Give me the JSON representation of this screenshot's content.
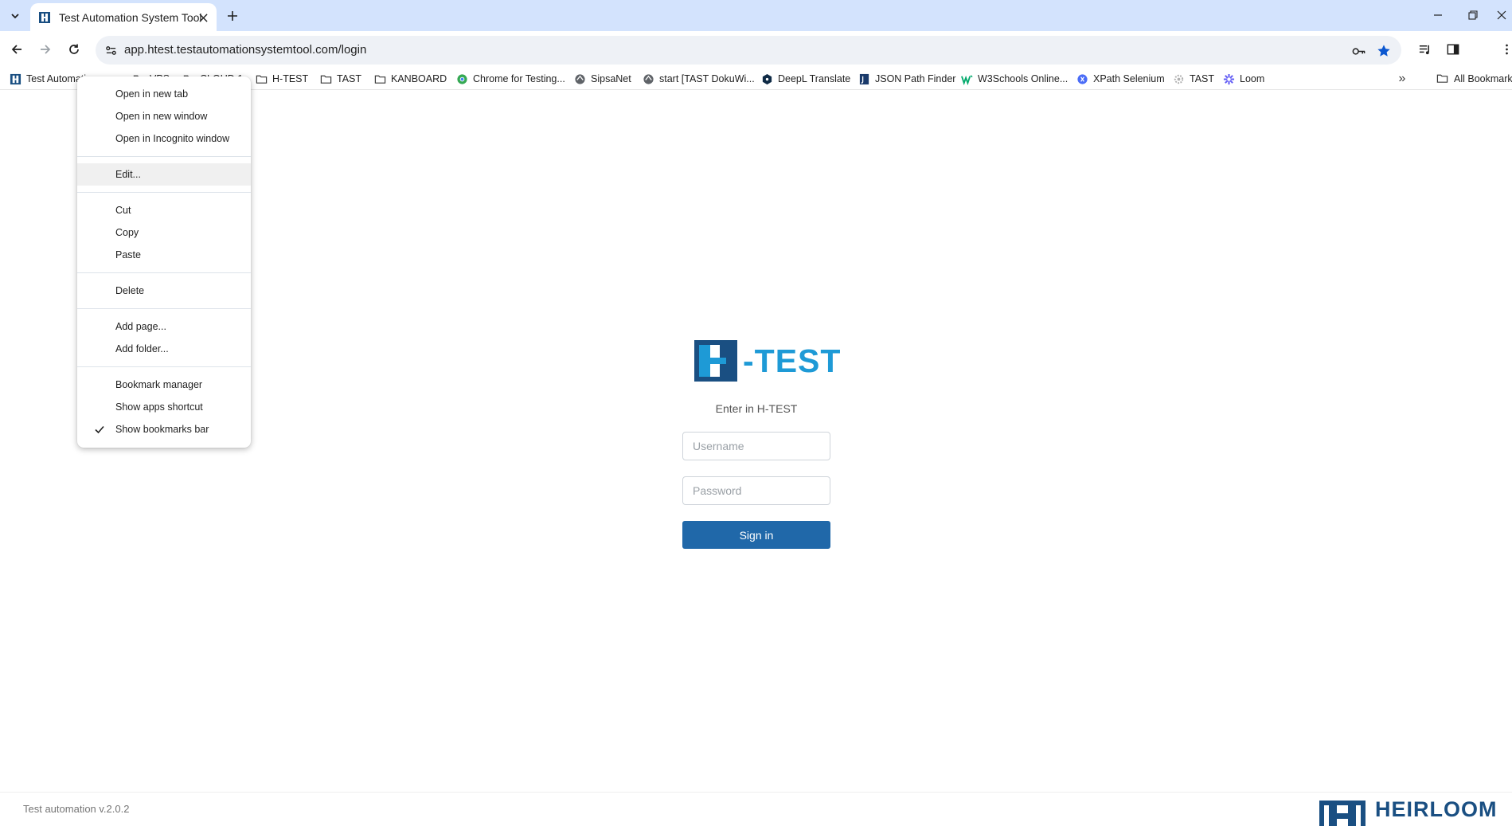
{
  "browser": {
    "tab": {
      "title": "Test Automation System Tool"
    },
    "url": "app.htest.testautomationsystemtool.com/login",
    "accent_color": "#d3e3fd",
    "bookmarks": [
      {
        "label": "Test Automati",
        "icon": "htest-favicon"
      },
      {
        "label": "VPS",
        "icon": "folder-icon"
      },
      {
        "label": "CLOUD 1",
        "icon": "folder-icon"
      },
      {
        "label": "H-TEST",
        "icon": "folder-icon"
      },
      {
        "label": "TAST",
        "icon": "folder-icon"
      },
      {
        "label": "KANBOARD",
        "icon": "folder-icon"
      },
      {
        "label": "Chrome for Testing...",
        "icon": "chrome-testing-icon"
      },
      {
        "label": "SipsaNet",
        "icon": "globe-icon"
      },
      {
        "label": "start [TAST DokuWi...",
        "icon": "globe-icon"
      },
      {
        "label": "DeepL Translate",
        "icon": "deepl-icon"
      },
      {
        "label": "JSON Path Finder",
        "icon": "json-icon"
      },
      {
        "label": "W3Schools Online...",
        "icon": "w3schools-icon"
      },
      {
        "label": "XPath Selenium",
        "icon": "xpath-icon"
      },
      {
        "label": "TAST",
        "icon": "gear-icon"
      },
      {
        "label": "Loom",
        "icon": "loom-icon"
      }
    ],
    "all_bookmarks": "All Bookmarks"
  },
  "context_menu": {
    "items": [
      "Open in new tab",
      "Open in new window",
      "Open in Incognito window",
      "Edit...",
      "Cut",
      "Copy",
      "Paste",
      "Delete",
      "Add page...",
      "Add folder...",
      "Bookmark manager",
      "Show apps shortcut",
      "Show bookmarks bar"
    ],
    "highlighted": "Edit...",
    "checked": "Show bookmarks bar"
  },
  "login": {
    "logo_text": "-TEST",
    "subtitle": "Enter in H-TEST",
    "username_placeholder": "Username",
    "password_placeholder": "Password",
    "signin_label": "Sign in",
    "button_color": "#2068a9",
    "brand_color": "#1e9ad6"
  },
  "footer": {
    "version": "Test automation v.2.0.2",
    "brand": "HEIRLOOM",
    "brand_color": "#1a4f82"
  }
}
